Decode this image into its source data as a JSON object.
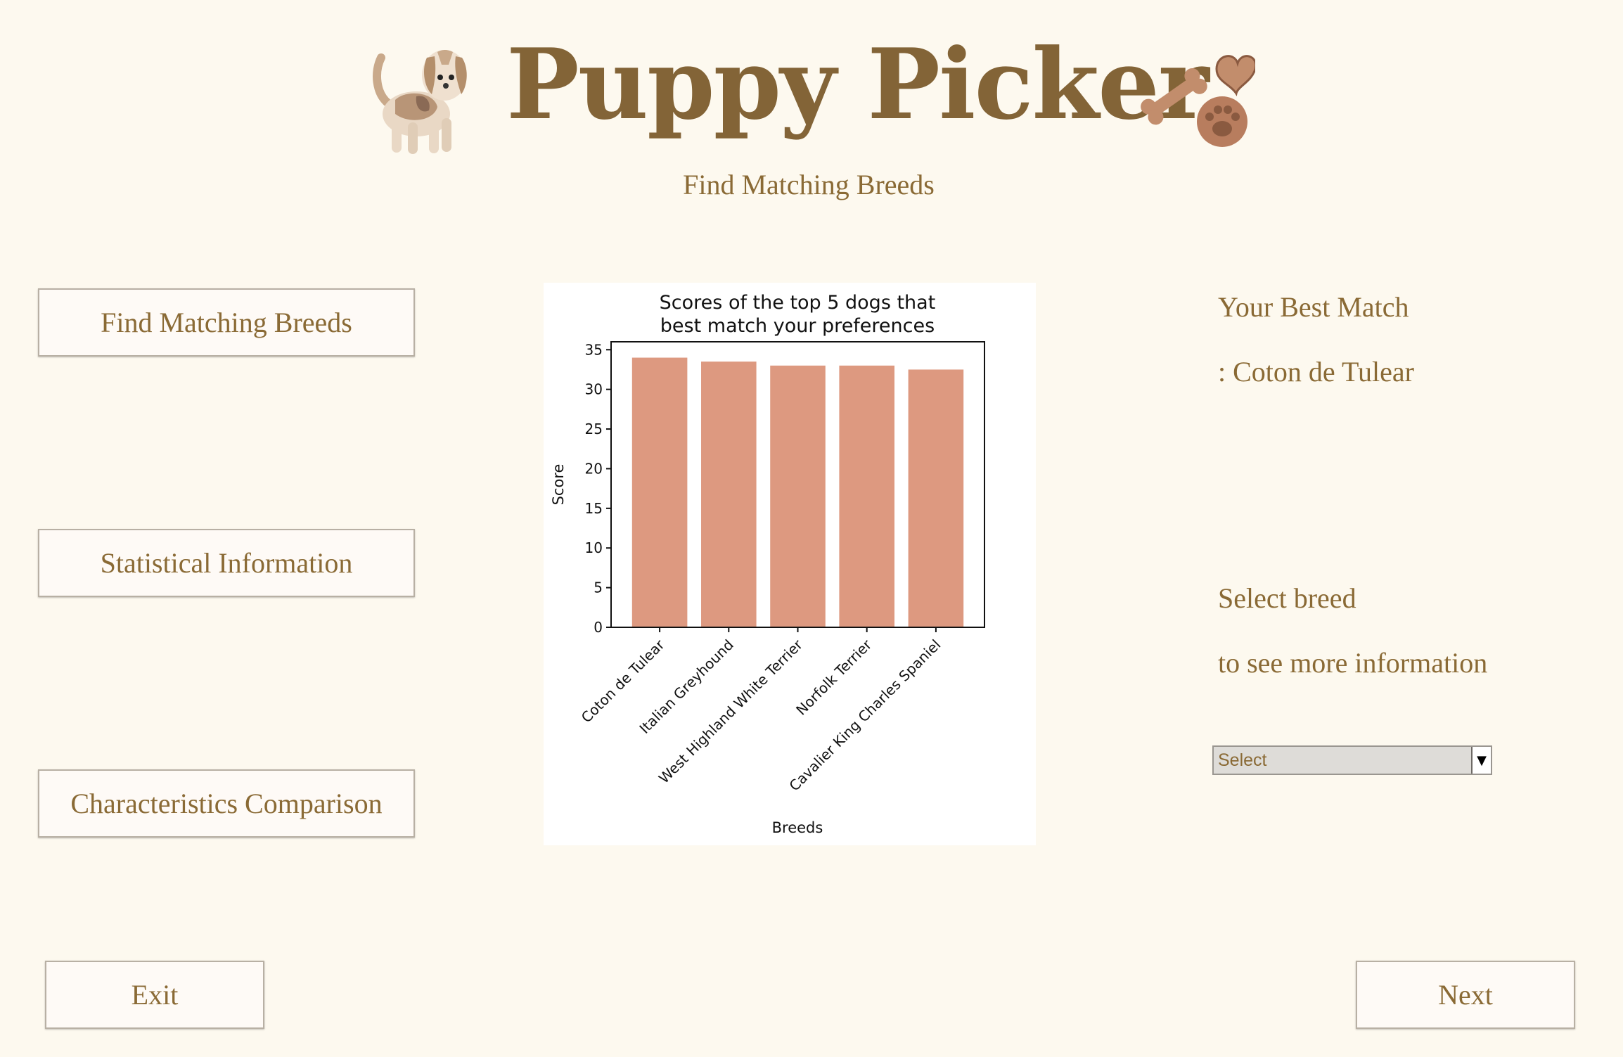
{
  "header": {
    "title": "Puppy Picker",
    "subtitle": "Find Matching Breeds"
  },
  "nav": {
    "find_label": "Find Matching Breeds",
    "stats_label": "Statistical Information",
    "compare_label": "Characteristics Comparison"
  },
  "footer": {
    "exit_label": "Exit",
    "next_label": "Next"
  },
  "result": {
    "best_match_label": "Your Best Match",
    "best_match_value": ": Coton de Tulear",
    "select_label": "Select breed",
    "select_hint": "to see more information",
    "select_value": "Select"
  },
  "chart_data": {
    "type": "bar",
    "title_line1": "Scores of the top 5 dogs that",
    "title_line2": "best match your preferences",
    "xlabel": "Breeds",
    "ylabel": "Score",
    "categories": [
      "Coton de Tulear",
      "Italian Greyhound",
      "West Highland White Terrier",
      "Norfolk Terrier",
      "Cavalier King Charles Spaniel"
    ],
    "values": [
      34,
      33.5,
      33,
      33,
      32.5
    ],
    "ylim": [
      0,
      36
    ],
    "yticks": [
      0,
      5,
      10,
      15,
      20,
      25,
      30,
      35
    ],
    "bar_color": "#dd9980",
    "grid": false
  },
  "icons": {
    "dog": "beagle-puppy-icon",
    "treats": "dog-treats-icon"
  }
}
